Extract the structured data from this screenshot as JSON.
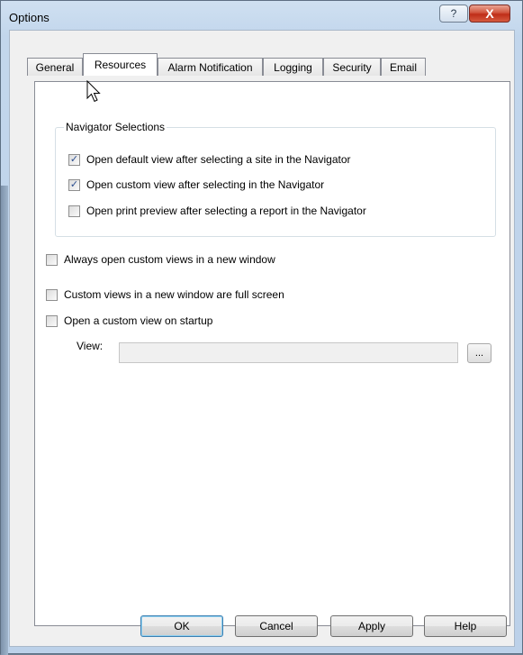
{
  "window": {
    "title": "Options",
    "help_symbol": "?",
    "close_symbol": "X"
  },
  "tabs": [
    {
      "label": "General"
    },
    {
      "label": "Resources"
    },
    {
      "label": "Alarm Notification"
    },
    {
      "label": "Logging"
    },
    {
      "label": "Security"
    },
    {
      "label": "Email"
    }
  ],
  "selected_tab": "Resources",
  "navigator_group": {
    "title": "Navigator Selections",
    "options": [
      {
        "label": "Open default view after selecting a site in the Navigator",
        "checked": true
      },
      {
        "label": "Open custom view after selecting in the Navigator",
        "checked": true
      },
      {
        "label": "Open print preview after selecting a report in the Navigator",
        "checked": false
      }
    ]
  },
  "options": [
    {
      "label": "Always open custom views in a new window",
      "checked": false
    },
    {
      "label": "Custom views in a new window are full screen",
      "checked": false
    },
    {
      "label": "Open a custom view on startup",
      "checked": false
    }
  ],
  "view_field": {
    "label": "View:",
    "value": "",
    "browse_label": "..."
  },
  "buttons": {
    "ok": "OK",
    "cancel": "Cancel",
    "apply": "Apply",
    "help": "Help"
  },
  "check_glyph": "✓"
}
